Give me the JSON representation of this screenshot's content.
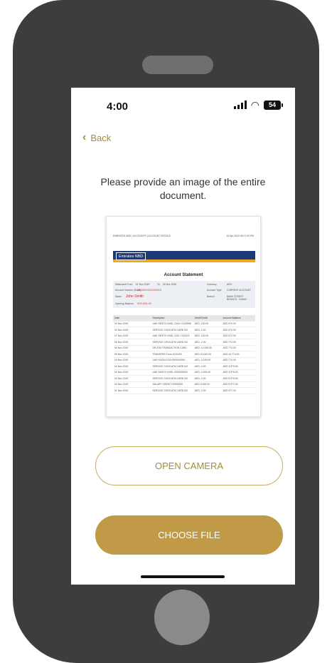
{
  "status_bar": {
    "time": "4:00",
    "battery": "54"
  },
  "nav": {
    "back_label": "Back"
  },
  "prompt": "Please provide an image of the entire document.",
  "document": {
    "header_left": "EMIRATES NBD | ACCOUNTS | ACCOUNT DETAILS",
    "header_right": "15 Apr 2020 04:07:03 PM",
    "logo": "Emirates NBD",
    "title": "Account Statement",
    "info": {
      "statement_from_label": "Statement From",
      "statement_from": "01 Nov 2019",
      "to_label": "To",
      "to": "30 Nov 2019",
      "currency_label": "Currency",
      "currency": "AED",
      "account_number_label": "Account Number (IBAN)",
      "account_number": "XXXXXXXXXXXXXXX",
      "account_type_label": "Account Type",
      "account_type": "CURRENT ACCOUNT",
      "name_label": "Name",
      "name": "John Smith",
      "branch_label": "Branch",
      "branch": "BANK STREET BRANCH - DUBAI",
      "opening_balance_label": "Opening Balance",
      "opening_balance": "XXX,XXX.XX"
    },
    "table_headers": [
      "Date",
      "Description",
      "Debit/Credit",
      "Account Balance"
    ],
    "rows": [
      [
        "30 Nov 2019",
        "UAE SWITCH WDL 1316 / 0143958",
        "AED -100.00",
        "AED 570.00"
      ],
      [
        "30 Nov 2019",
        "SERVICE CHGS ATM CARD NO",
        "AED -2.00",
        "AED 670.00"
      ],
      [
        "07 Nov 2019",
        "UAE SWITCH WDL 1311 / 004374",
        "AED -100.00",
        "AED 672.00"
      ],
      [
        "06 Nov 2019",
        "SERVICE CHGS ATM CARD NO",
        "AED -2.00",
        "AED 772.00"
      ],
      [
        "06 Nov 2019",
        "DR ATM TRANSACTION CARD",
        "AED -10,000.00",
        "AED 774.00"
      ],
      [
        "05 Nov 2019",
        "TRANSFER From 1011629",
        "AED 10,000.00",
        "AED 10,774.00"
      ],
      [
        "04 Nov 2019",
        "UAE NOON S A0 0000000000",
        "AED -3,199.00",
        "AED 774.00"
      ],
      [
        "04 Nov 2019",
        "SERVICE CHGS ATM CARD NO",
        "AED -2.00",
        "AED 3,973.00"
      ],
      [
        "02 Nov 2019",
        "UAE SWITCH WDL 0000000000",
        "AED -2,000.00",
        "AED 3,975.00"
      ],
      [
        "02 Nov 2019",
        "SERVICE CHGS ATM CARD NO",
        "AED -2.00",
        "AED 5,975.00"
      ],
      [
        "02 Nov 2019",
        "SALARY CREDIT 00000000",
        "AED 5,000.00",
        "AED 5,977.00"
      ],
      [
        "01 Nov 2019",
        "SERVICE CHGS ATM CARD NO",
        "AED -2.00",
        "AED 977.00"
      ]
    ]
  },
  "buttons": {
    "open_camera": "OPEN CAMERA",
    "choose_file": "CHOOSE FILE"
  },
  "colors": {
    "accent": "#c09a47",
    "bank_blue": "#1d3a78",
    "bank_yellow": "#f0a81e"
  }
}
